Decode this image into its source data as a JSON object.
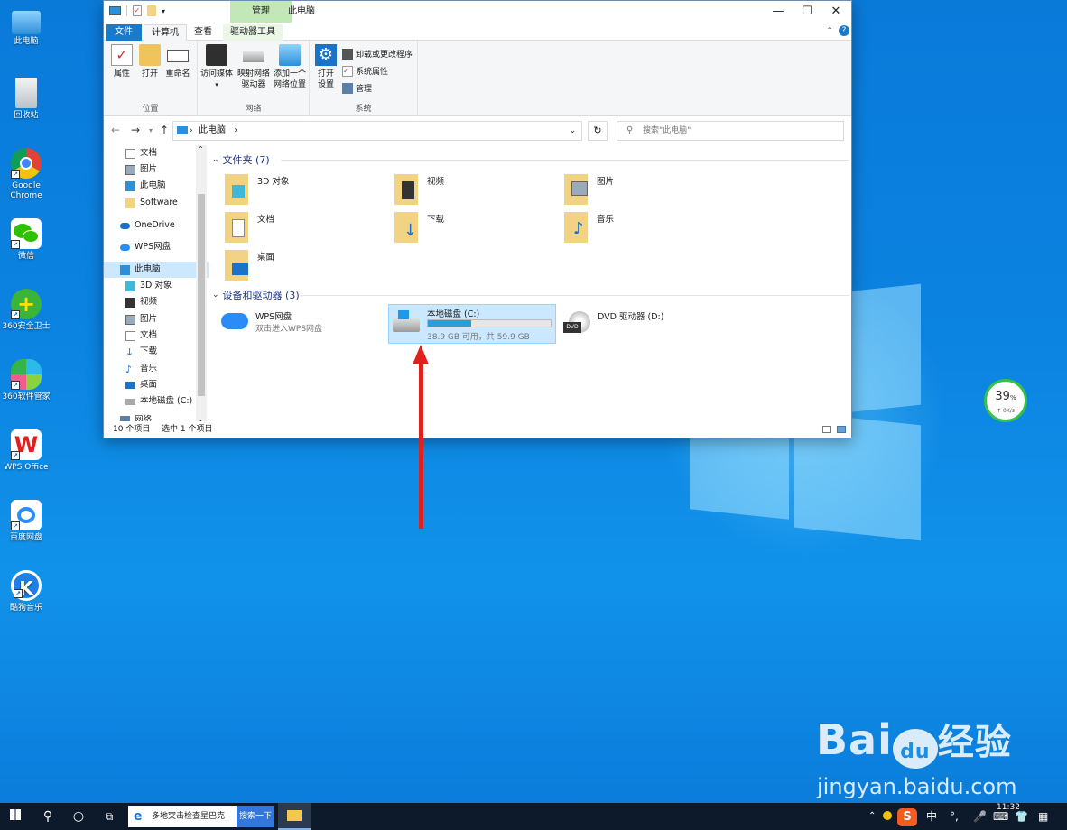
{
  "desktop": {
    "icons": [
      {
        "label": "此电脑",
        "icon": "computer-icon"
      },
      {
        "label": "回收站",
        "icon": "recycle-bin-icon"
      },
      {
        "label": "Google\nChrome",
        "icon": "chrome-icon"
      },
      {
        "label": "微信",
        "icon": "wechat-icon"
      },
      {
        "label": "360安全卫士",
        "icon": "360-safe-icon"
      },
      {
        "label": "360软件管家",
        "icon": "360-software-icon"
      },
      {
        "label": "WPS Office",
        "icon": "wps-icon"
      },
      {
        "label": "百度网盘",
        "icon": "baidu-netdisk-icon"
      },
      {
        "label": "酷狗音乐",
        "icon": "kugou-icon"
      }
    ]
  },
  "window": {
    "title": "此电脑",
    "context_tab": "管理",
    "tabs": {
      "file": "文件",
      "computer": "计算机",
      "view": "查看",
      "drive_tools": "驱动器工具"
    },
    "ribbon": {
      "location_group": "位置",
      "network_group": "网络",
      "system_group": "系统",
      "properties": "属性",
      "open": "打开",
      "rename": "重命名",
      "access_media": "访问媒体",
      "map_drive_1": "映射网络",
      "map_drive_2": "驱动器",
      "add_location_1": "添加一个",
      "add_location_2": "网络位置",
      "open_settings_1": "打开",
      "open_settings_2": "设置",
      "uninstall": "卸载或更改程序",
      "system_props": "系统属性",
      "manage": "管理"
    },
    "address": {
      "path": "此电脑",
      "search_placeholder": "搜索\"此电脑\""
    },
    "nav_pane": [
      {
        "label": "文档",
        "pin": true
      },
      {
        "label": "图片",
        "pin": true
      },
      {
        "label": "此电脑",
        "pin": true
      },
      {
        "label": "Software",
        "pin": true
      },
      {
        "label": "OneDrive"
      },
      {
        "label": "WPS网盘"
      },
      {
        "label": "此电脑",
        "selected": true
      },
      {
        "label": "3D 对象"
      },
      {
        "label": "视频"
      },
      {
        "label": "图片"
      },
      {
        "label": "文档"
      },
      {
        "label": "下载"
      },
      {
        "label": "音乐"
      },
      {
        "label": "桌面"
      },
      {
        "label": "本地磁盘 (C:)"
      },
      {
        "label": "网络"
      }
    ],
    "folders_header": "文件夹 (7)",
    "folders": [
      "3D 对象",
      "视频",
      "图片",
      "文档",
      "下载",
      "音乐",
      "桌面"
    ],
    "devices_header": "设备和驱动器 (3)",
    "devices": {
      "wps": {
        "name": "WPS网盘",
        "sub": "双击进入WPS网盘"
      },
      "c": {
        "name": "本地磁盘 (C:)",
        "sub": "38.9 GB 可用，共 59.9 GB",
        "used_fraction": 0.35
      },
      "dvd": {
        "name": "DVD 驱动器 (D:)"
      }
    },
    "status": {
      "count": "10 个项目",
      "selected": "选中 1 个项目"
    }
  },
  "widget": {
    "percent": "39",
    "percent_sign": "%",
    "speed": "0K/s"
  },
  "watermark": {
    "brand": "Bai du 经验",
    "url": "jingyan.baidu.com"
  },
  "taskbar": {
    "search_text": "多地突击检查星巴克",
    "search_button": "搜索一下",
    "ime": "中",
    "time": "11:32"
  }
}
